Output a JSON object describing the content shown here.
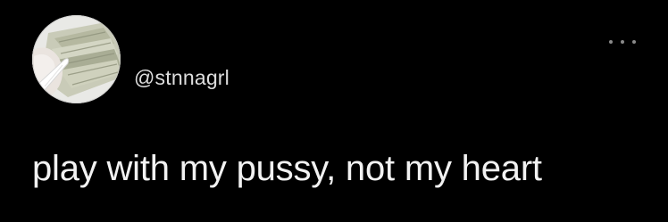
{
  "tweet": {
    "handle": "@stnnagrl",
    "text": "play with my pussy, not my heart",
    "avatar_icon": "avatar-photo-money-hand",
    "more_icon": "more-options-icon"
  },
  "colors": {
    "background": "#000000",
    "text": "#f2f2f2",
    "handle": "#dedede",
    "more_dots": "#8a8a8a"
  }
}
